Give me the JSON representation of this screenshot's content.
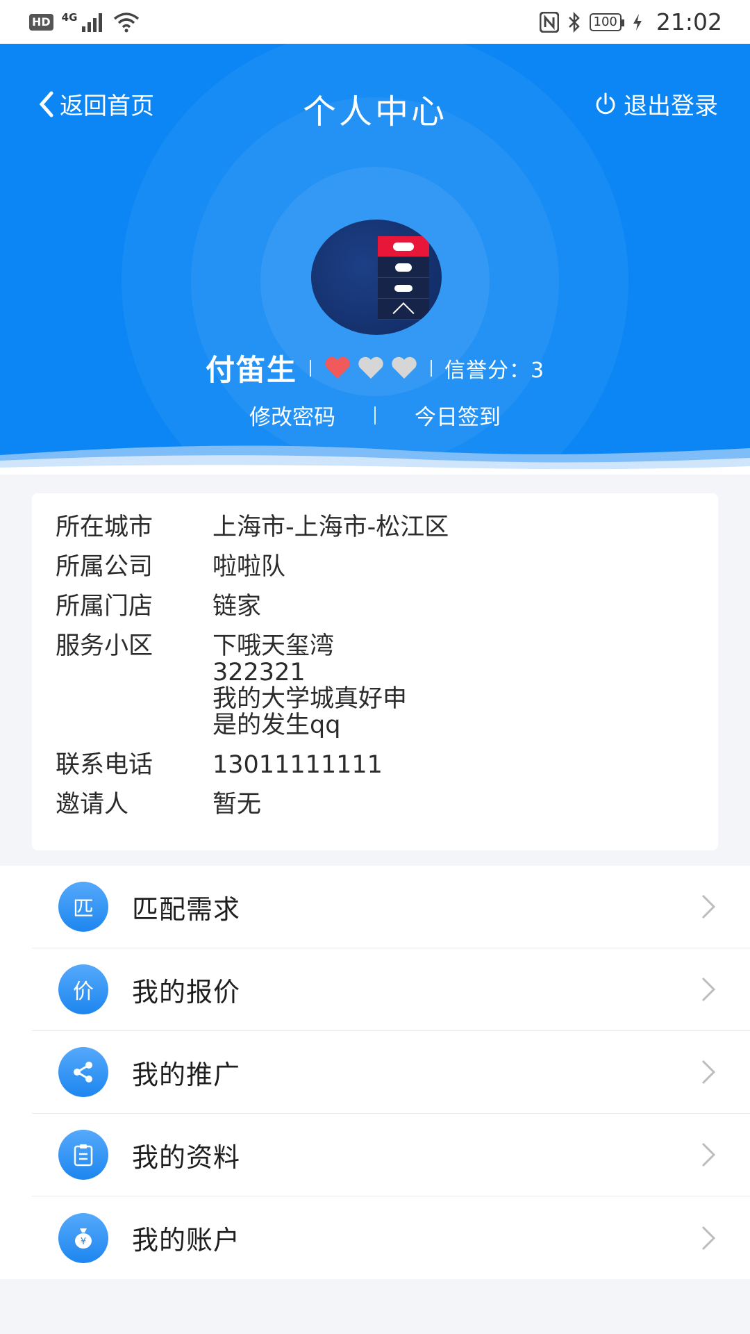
{
  "status_bar": {
    "hd": "HD",
    "network": "4G",
    "battery": "100",
    "time": "21:02"
  },
  "header": {
    "back_label": "返回首页",
    "title": "个人中心",
    "logout_label": "退出登录",
    "user_name": "付笛生",
    "credit_label": "信誉分：3",
    "change_password": "修改密码",
    "daily_checkin": "今日签到",
    "accent_color": "#0b86f4",
    "heart_active_color": "#f05a5a",
    "heart_inactive_color": "#d6d6d6",
    "rating_hearts_filled": 1,
    "rating_hearts_total": 3
  },
  "info": {
    "city_label": "所在城市",
    "city_value": "上海市-上海市-松江区",
    "company_label": "所属公司",
    "company_value": "啦啦队",
    "store_label": "所属门店",
    "store_value": "链家",
    "community_label": "服务小区",
    "community_value": "下哦天玺湾\n322321\n我的大学城真好申\n是的发生qq",
    "phone_label": "联系电话",
    "phone_value": "13011111111",
    "inviter_label": "邀请人",
    "inviter_value": "暂无"
  },
  "menu": {
    "items": [
      {
        "label": "匹配需求",
        "icon_text": "匹",
        "icon": "match-icon"
      },
      {
        "label": "我的报价",
        "icon_text": "价",
        "icon": "quote-icon"
      },
      {
        "label": "我的推广",
        "icon_text": "",
        "icon": "share-icon"
      },
      {
        "label": "我的资料",
        "icon_text": "",
        "icon": "clipboard-icon"
      },
      {
        "label": "我的账户",
        "icon_text": "¥",
        "icon": "money-bag-icon"
      }
    ]
  }
}
